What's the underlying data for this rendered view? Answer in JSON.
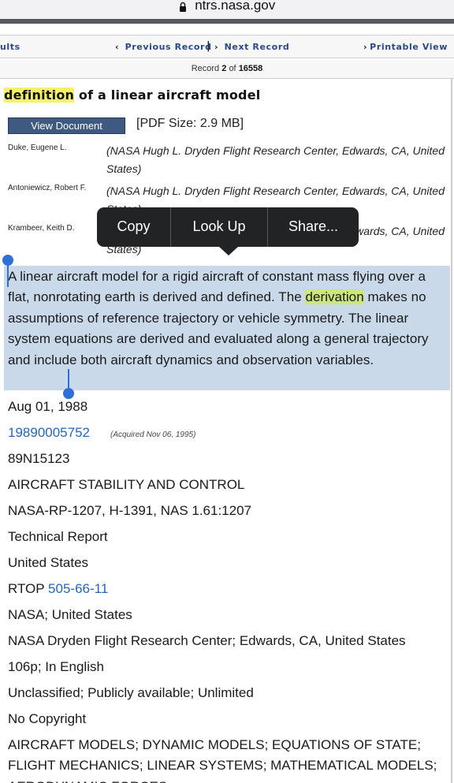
{
  "browser": {
    "domain": "ntrs.nasa.gov"
  },
  "nav": {
    "results_label": "ults",
    "prev_label": "Previous Record",
    "separator": "|",
    "next_label": "Next Record",
    "print_label": "Printable View",
    "chevron_left": "‹",
    "chevron_right": "›"
  },
  "record": {
    "prefix": "Record",
    "index": "2",
    "of_label": "of",
    "total": "16558"
  },
  "title": {
    "highlighted": "definition",
    "rest": " of a linear aircraft model"
  },
  "document": {
    "view_button": "View Document",
    "pdf_size": "[PDF Size: 2.9 MB]"
  },
  "authors": [
    {
      "name": "Duke, Eugene L.",
      "affiliation": "(NASA Hugh L. Dryden Flight Research Center, Edwards, CA, United States)"
    },
    {
      "name": "Antoniewicz, Robert F.",
      "affiliation": "(NASA Hugh L. Dryden Flight Research Center, Edwards, CA, United States)"
    },
    {
      "name": "Krambeer, Keith D.",
      "affiliation": "(NASA Hugh L. Dryden Flight Research Center, Edwards, CA, United States)"
    }
  ],
  "context_menu": {
    "copy": "Copy",
    "lookup": "Look Up",
    "share": "Share..."
  },
  "abstract": {
    "before": "A linear aircraft model for a rigid aircraft of constant mass flying over a flat, nonrotating earth is derived and defined. The ",
    "highlighted": "derivation",
    "after": " makes no assumptions of reference trajectory or vehicle symmetry. The linear system equations are derived and evaluated along a general trajectory and include both aircraft dynamics and observation variables."
  },
  "fields": {
    "date": "Aug 01, 1988",
    "doc_id": "19890005752",
    "acquired": "(Acquired Nov 06, 1995)",
    "accession": "89N15123",
    "category": "AIRCRAFT STABILITY AND CONTROL",
    "report_numbers": "NASA-RP-1207, H-1391, NAS 1.61:1207",
    "doc_type": "Technical Report",
    "country": "United States",
    "rtop_label": "RTOP",
    "rtop_number": "505-66-11",
    "funding": "NASA; United States",
    "organization": "NASA Dryden Flight Research Center; Edwards, CA, United States",
    "pages_language": "106p; In English",
    "availability": "Unclassified; Publicly available; Unlimited",
    "copyright": "No Copyright",
    "subjects": "AIRCRAFT MODELS; DYNAMIC MODELS; EQUATIONS OF STATE; FLIGHT MECHANICS; LINEAR SYSTEMS; MATHEMATICAL MODELS; AERODYNAMIC FORCES"
  }
}
